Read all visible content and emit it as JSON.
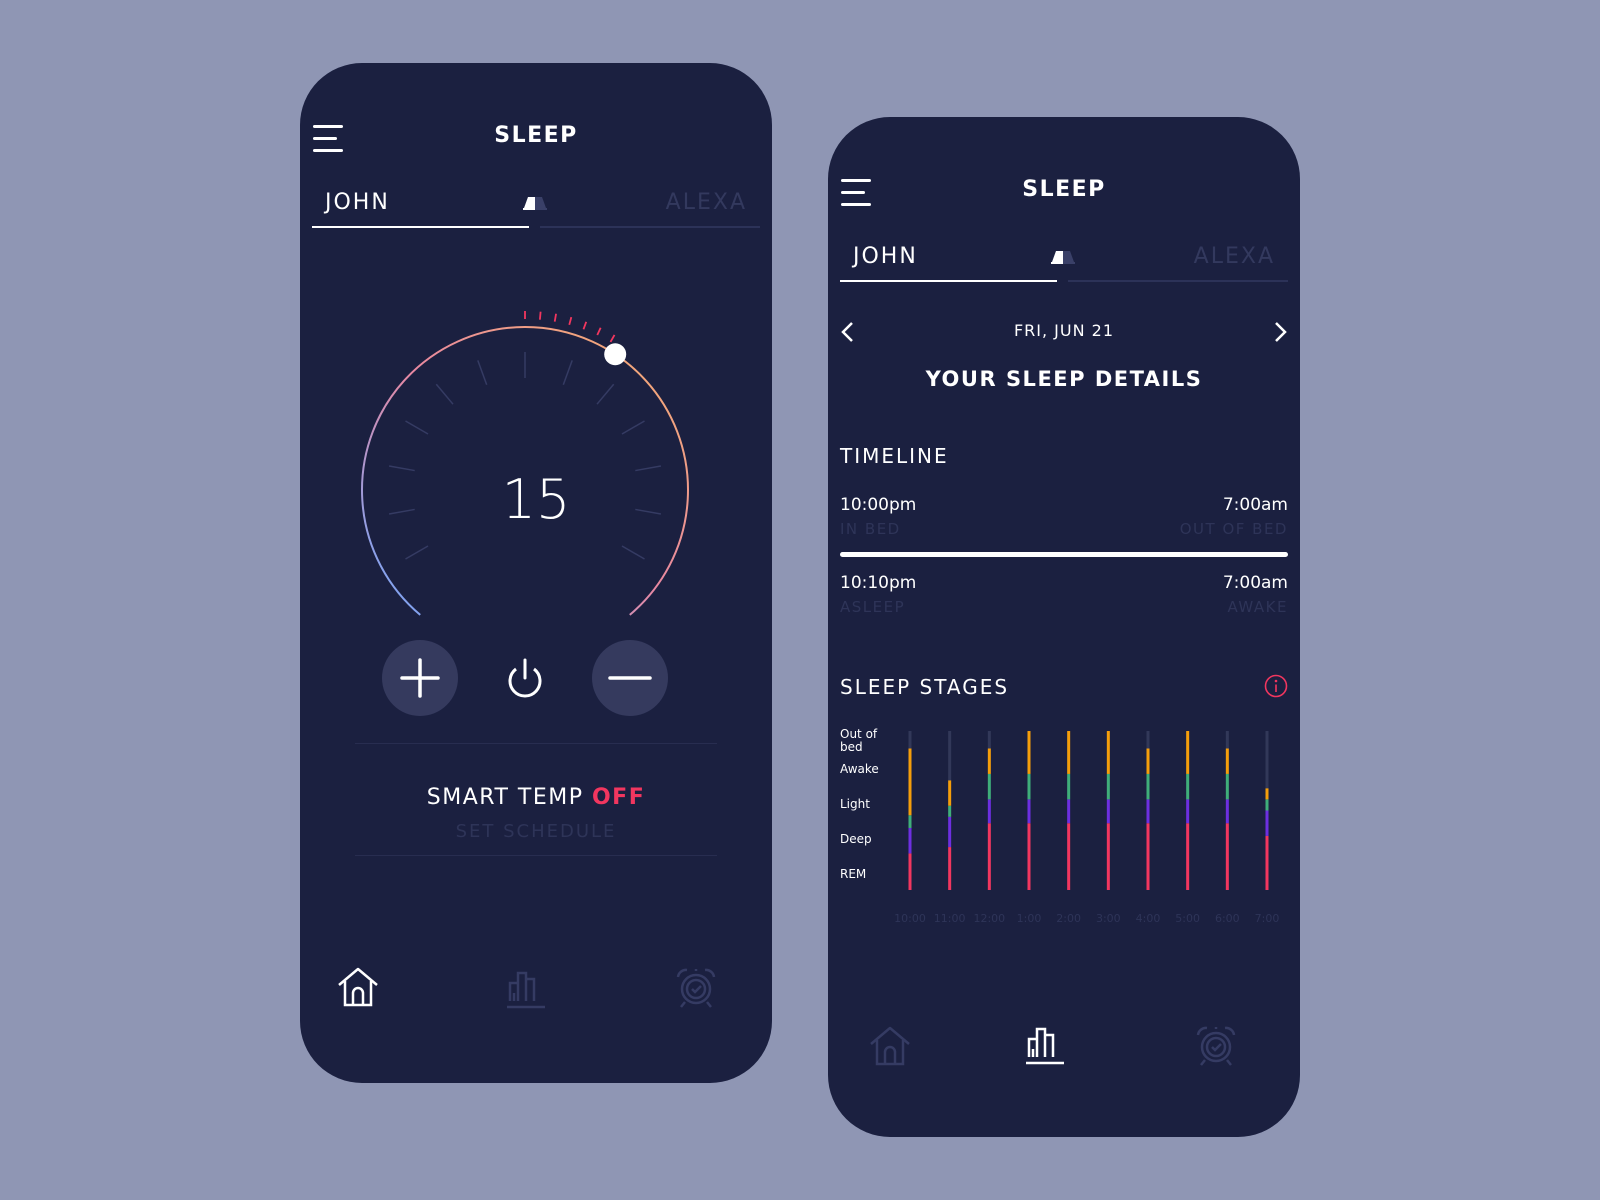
{
  "colors": {
    "background": "#8f96b4",
    "phone": "#1b2040",
    "accent": "#f2365f",
    "muted": "#2e3458",
    "stage_out_of_bed": "#323859",
    "stage_awake": "#f59e0b",
    "stage_light": "#3fae7a",
    "stage_deep": "#6d2fe0",
    "stage_rem": "#f2365f"
  },
  "screen1": {
    "title": "SLEEP",
    "tabs": {
      "left": "JOHN",
      "right": "ALEXA"
    },
    "dial": {
      "value": "15",
      "level_fraction": 0.62
    },
    "controls": {
      "plus": "increase",
      "power": "power",
      "minus": "decrease"
    },
    "smart_temp": {
      "label": "SMART TEMP",
      "state": "OFF"
    },
    "schedule": "SET SCHEDULE",
    "nav": [
      {
        "icon": "home-icon",
        "active": true
      },
      {
        "icon": "chart-icon",
        "active": false
      },
      {
        "icon": "alarm-icon",
        "active": false
      }
    ]
  },
  "screen2": {
    "title": "SLEEP",
    "tabs": {
      "left": "JOHN",
      "right": "ALEXA"
    },
    "date": "FRI, JUN 21",
    "heading": "YOUR SLEEP DETAILS",
    "timeline": {
      "title": "TIMELINE",
      "in_bed_time": "10:00pm",
      "in_bed_label": "IN BED",
      "out_of_bed_time": "7:00am",
      "out_of_bed_label": "OUT OF BED",
      "asleep_time": "10:10pm",
      "asleep_label": "ASLEEP",
      "awake_time": "7:00am",
      "awake_label": "AWAKE"
    },
    "stages_title": "SLEEP STAGES"
  },
  "chart_data": {
    "type": "bar",
    "title": "SLEEP STAGES",
    "stage_labels": [
      "Out of bed",
      "Awake",
      "Light",
      "Deep",
      "REM"
    ],
    "categories": [
      "10:00",
      "11:00",
      "12:00",
      "1:00",
      "2:00",
      "3:00",
      "4:00",
      "5:00",
      "6:00",
      "7:00"
    ],
    "note": "Each bar is a stacked column; values are fractions of full column height from bottom (REM) to top (Out of bed).",
    "series": [
      {
        "name": "REM",
        "values": [
          0.23,
          0.27,
          0.42,
          0.42,
          0.42,
          0.42,
          0.42,
          0.42,
          0.42,
          0.34
        ]
      },
      {
        "name": "Deep",
        "values": [
          0.16,
          0.19,
          0.15,
          0.15,
          0.15,
          0.15,
          0.15,
          0.15,
          0.15,
          0.16
        ]
      },
      {
        "name": "Light",
        "values": [
          0.08,
          0.07,
          0.16,
          0.16,
          0.16,
          0.16,
          0.16,
          0.16,
          0.16,
          0.07
        ]
      },
      {
        "name": "Awake",
        "values": [
          0.42,
          0.16,
          0.16,
          0.27,
          0.27,
          0.27,
          0.16,
          0.27,
          0.16,
          0.07
        ]
      },
      {
        "name": "Out of bed",
        "values": [
          0.11,
          0.31,
          0.11,
          0.0,
          0.0,
          0.0,
          0.11,
          0.0,
          0.11,
          0.36
        ]
      }
    ]
  }
}
